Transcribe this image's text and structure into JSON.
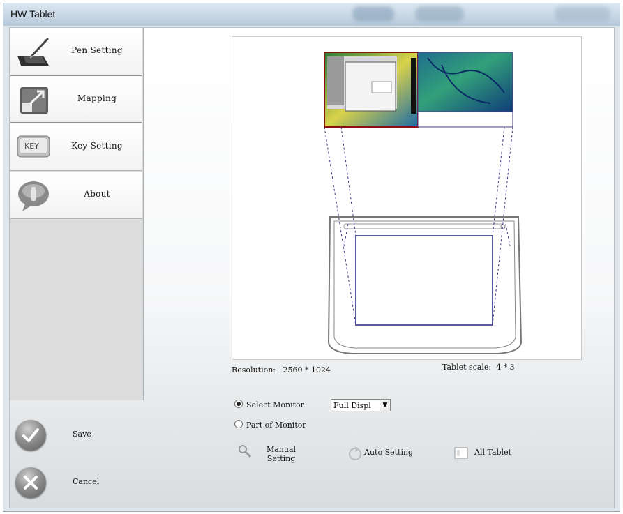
{
  "window": {
    "title": "HW Tablet"
  },
  "sidebar": {
    "items": [
      {
        "label": "Pen Setting",
        "icon": "pen-tablet-icon"
      },
      {
        "label": "Mapping",
        "icon": "mapping-arrow-icon"
      },
      {
        "label": "Key Setting",
        "icon": "key-icon"
      },
      {
        "label": "About",
        "icon": "speech-bubble-icon"
      }
    ],
    "save_label": "Save",
    "cancel_label": "Cancel"
  },
  "main": {
    "resolution_label": "Resolution:",
    "resolution_value": "2560 * 1024",
    "scale_label": "Tablet scale:",
    "scale_value": "4 * 3",
    "select_monitor_label": "Select Monitor",
    "monitor_option": "Full Displ",
    "part_of_monitor_label": "Part of Monitor",
    "manual_setting_label_1": "Manual",
    "manual_setting_label_2": "Setting",
    "auto_setting_label": "Auto Setting",
    "all_tablet_label": "All Tablet"
  },
  "colors": {
    "window_chrome": "#c6d6e4",
    "sidebar_bg": "#dcdcdc",
    "mapping_line": "#3a3a8a"
  }
}
